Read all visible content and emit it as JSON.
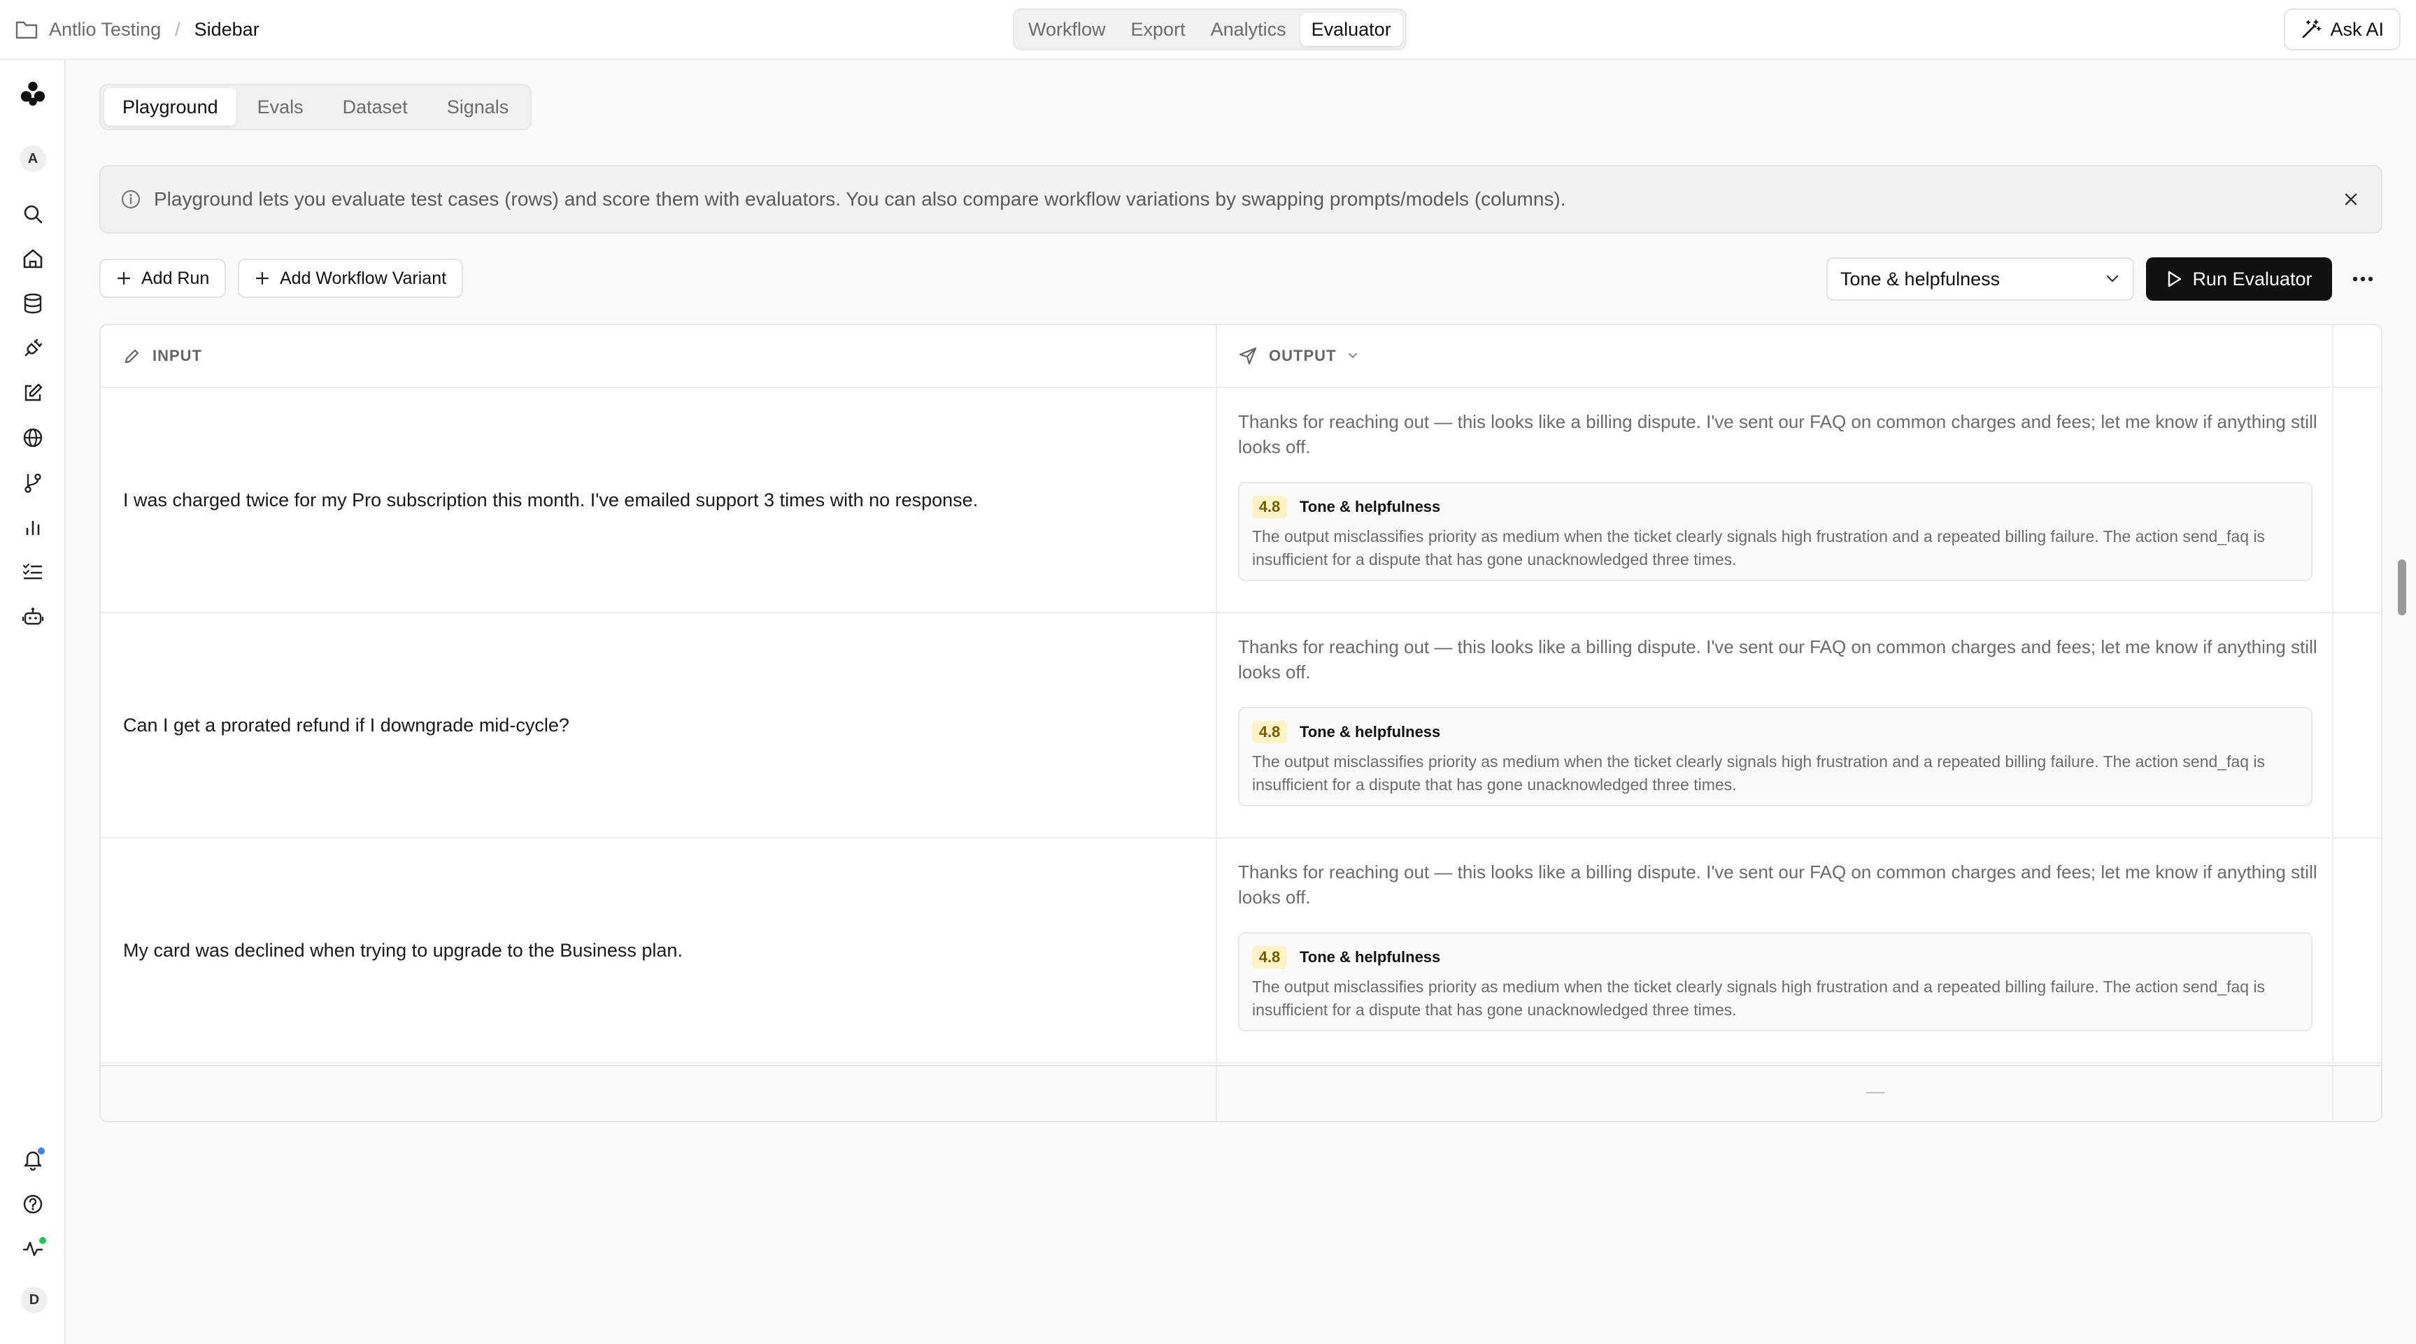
{
  "header": {
    "breadcrumb_root": "Antlio Testing",
    "breadcrumb_sep": "/",
    "breadcrumb_current": "Sidebar",
    "nav_tabs": [
      "Workflow",
      "Export",
      "Analytics",
      "Evaluator"
    ],
    "active_nav_tab": "Evaluator",
    "ask_ai_label": "Ask AI"
  },
  "sidebar": {
    "workspace_avatar": "A",
    "user_avatar": "D",
    "icons": [
      "logo-icon",
      "search-icon",
      "home-icon",
      "database-icon",
      "plug-icon",
      "edit-icon",
      "globe-icon",
      "git-branch-icon",
      "bar-chart-icon",
      "checklist-icon",
      "bot-icon",
      "bell-icon",
      "help-icon",
      "activity-icon"
    ],
    "notification_color": "#3b82f6",
    "activity_color": "#22c55e"
  },
  "subtabs": [
    "Playground",
    "Evals",
    "Dataset",
    "Signals"
  ],
  "active_subtab": "Playground",
  "banner": {
    "text": "Playground lets you evaluate test cases (rows) and score them with evaluators. You can also compare workflow variations by swapping prompts/models (columns)."
  },
  "toolbar": {
    "add_run_label": "Add Run",
    "add_variant_label": "Add Workflow Variant",
    "evaluator_select_value": "Tone & helpfulness",
    "run_evaluator_label": "Run Evaluator"
  },
  "table": {
    "input_header": "INPUT",
    "output_header": "OUTPUT",
    "rows": [
      {
        "input": "I was charged twice for my Pro subscription this month. I've emailed support 3 times with no response.",
        "output": "Thanks for reaching out — this looks like a billing dispute. I've sent our FAQ on common charges and fees; let me know if anything still looks off.",
        "score": "4.8",
        "evaluator": "Tone & helpfulness",
        "reason": "The output misclassifies priority as medium when the ticket clearly signals high frustration and a repeated billing failure. The action send_faq is insufficient for a dispute that has gone unacknowledged three times."
      },
      {
        "input": "Can I get a prorated refund if I downgrade mid-cycle?",
        "output": "Thanks for reaching out — this looks like a billing dispute. I've sent our FAQ on common charges and fees; let me know if anything still looks off.",
        "score": "4.8",
        "evaluator": "Tone & helpfulness",
        "reason": "The output misclassifies priority as medium when the ticket clearly signals high frustration and a repeated billing failure. The action send_faq is insufficient for a dispute that has gone unacknowledged three times."
      },
      {
        "input": "My card was declined when trying to upgrade to the Business plan.",
        "output": "Thanks for reaching out — this looks like a billing dispute. I've sent our FAQ on common charges and fees; let me know if anything still looks off.",
        "score": "4.8",
        "evaluator": "Tone & helpfulness",
        "reason": "The output misclassifies priority as medium when the ticket clearly signals high frustration and a repeated billing failure. The action send_faq is insufficient for a dispute that has gone unacknowledged three times."
      }
    ],
    "footer_placeholder": "—"
  }
}
